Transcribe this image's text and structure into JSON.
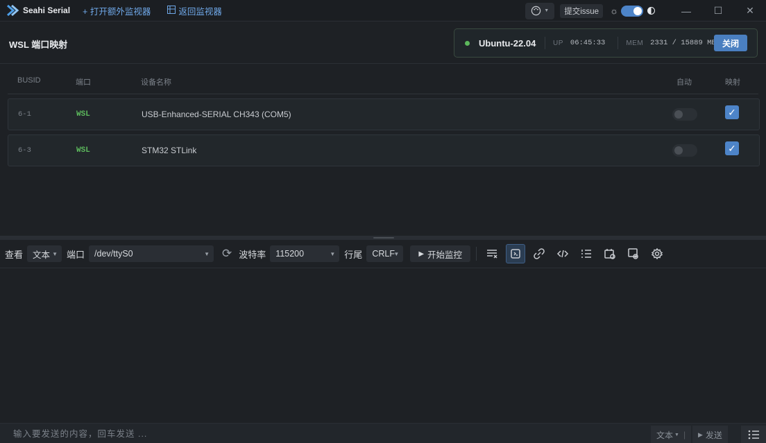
{
  "titlebar": {
    "app_name": "Seahi Serial",
    "open_extra_monitor": "+ 打开额外监视器",
    "back_to_monitor": "返回监视器",
    "issue_label": "提交issue"
  },
  "header": {
    "title": "WSL 端口映射",
    "distro": "Ubuntu-22.04",
    "up_label": "UP",
    "up_value": "06:45:33",
    "mem_label": "MEM",
    "mem_value": "2331 / 15889 MB",
    "close_label": "关闭"
  },
  "table": {
    "columns": [
      "BUSID",
      "端口",
      "设备名称",
      "自动",
      "映射"
    ],
    "rows": [
      {
        "busid": "6-1",
        "port": "WSL",
        "device": "USB-Enhanced-SERIAL CH343 (COM5)",
        "auto": false,
        "mapped": true
      },
      {
        "busid": "6-3",
        "port": "WSL",
        "device": "STM32 STLink",
        "auto": false,
        "mapped": true
      }
    ]
  },
  "toolbar": {
    "view_label": "查看",
    "view_value": "文本",
    "port_label": "端口",
    "port_value": "/dev/ttyS0",
    "baud_label": "波特率",
    "baud_value": "115200",
    "eol_label": "行尾",
    "eol_value": "CRLF",
    "start_label": "开始监控"
  },
  "bottom": {
    "placeholder": "输入要发送的内容，回车发送 ...",
    "format_value": "文本",
    "send_label": "发送"
  },
  "colors": {
    "accent": "#4d84c8",
    "status_green": "#5cb85c",
    "background": "#1e2125"
  }
}
